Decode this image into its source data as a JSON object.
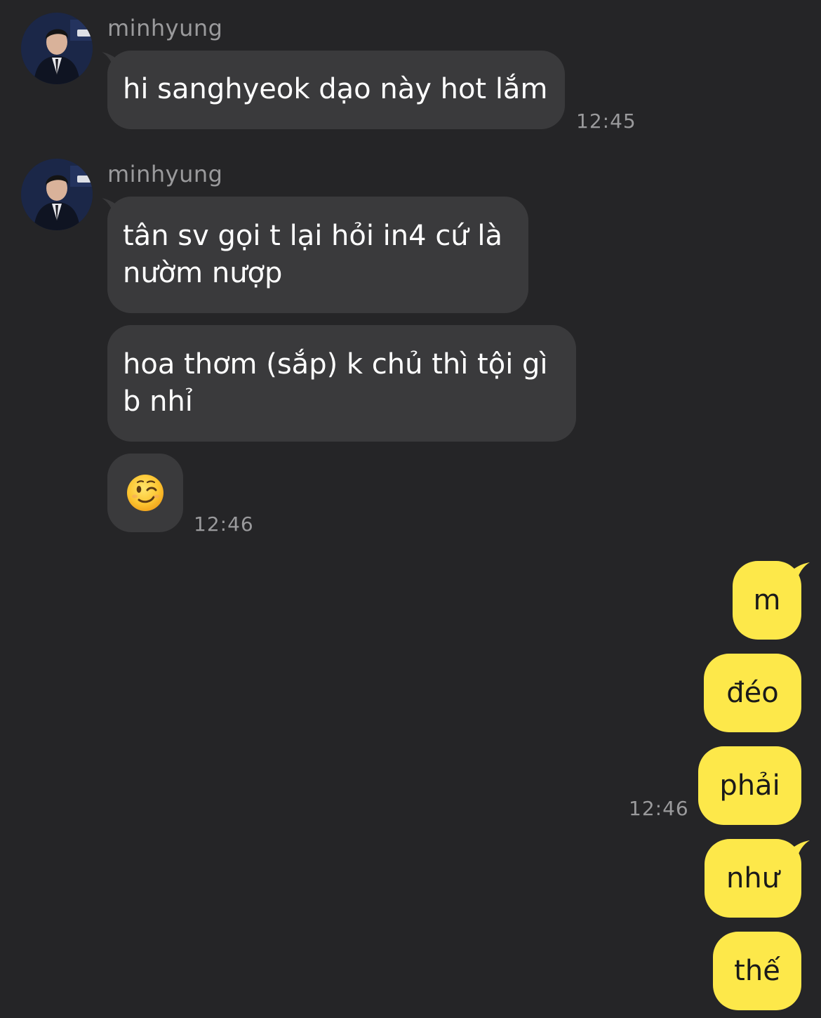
{
  "chat": {
    "contact": {
      "name": "minhyung",
      "avatar": "avatar-photo"
    },
    "incoming_group_1": {
      "sender": "minhyung",
      "messages": [
        "hi sanghyeok dạo này hot lắm"
      ],
      "time": "12:45"
    },
    "incoming_group_2": {
      "sender": "minhyung",
      "messages": [
        "tân sv gọi t lại hỏi in4 cứ là nườm nượp",
        "hoa thơm (sắp) k chủ thì tội gì b nhỉ"
      ],
      "emoji": "winking-face",
      "time": "12:46"
    },
    "outgoing_group": {
      "messages": [
        "m",
        "đéo",
        "phải",
        "như",
        "thế"
      ],
      "time": "12:46"
    },
    "colors": {
      "background": "#252527",
      "incoming_bubble": "#3a3a3c",
      "outgoing_bubble": "#fde84a",
      "secondary_text": "#9a9a9c"
    }
  }
}
